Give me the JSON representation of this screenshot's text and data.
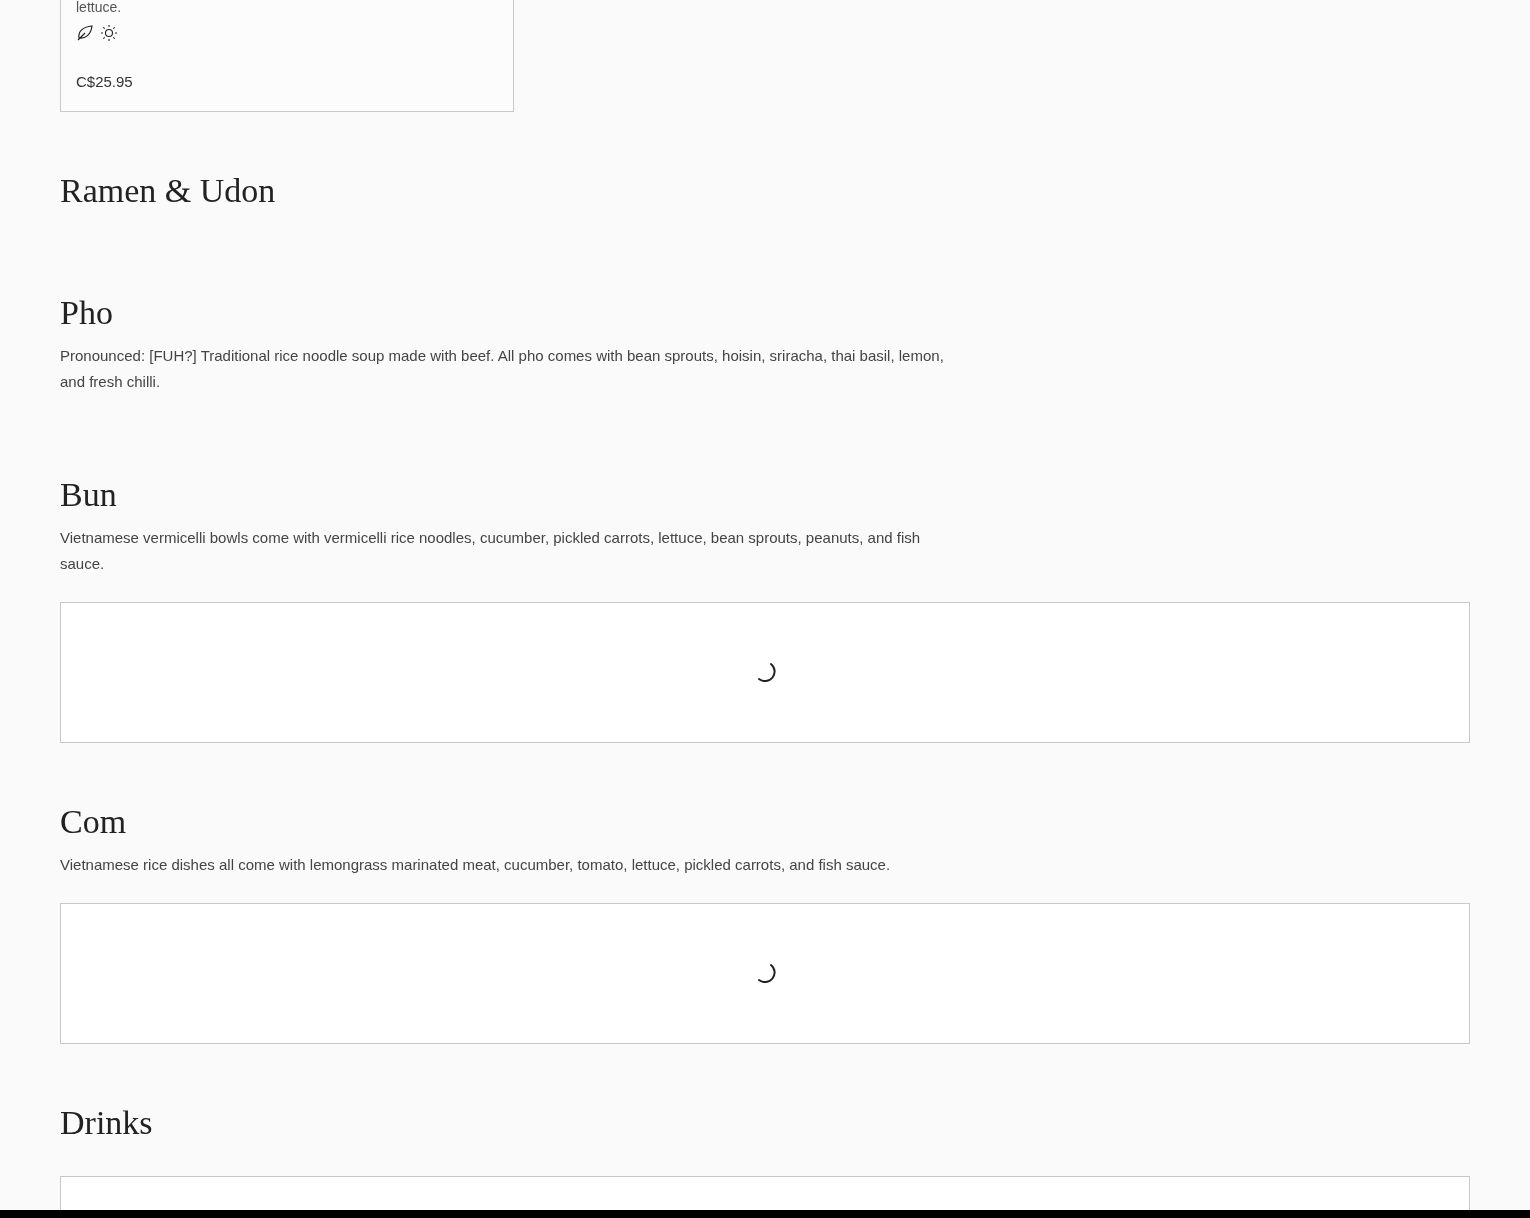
{
  "top_card": {
    "description": "lettuce.",
    "price": "C$25.95"
  },
  "sections": [
    {
      "title": "Ramen & Udon",
      "loading": false
    },
    {
      "title": "Pho",
      "description": "Pronounced: [FUH?] Traditional rice noodle soup made with beef. All pho comes with bean sprouts, hoisin, sriracha, thai basil, lemon, and fresh chilli.",
      "loading": false
    },
    {
      "title": "Bun",
      "description": "Vietnamese vermicelli bowls come with vermicelli rice noodles, cucumber, pickled carrots, lettuce, bean sprouts, peanuts, and fish sauce.",
      "loading": true
    },
    {
      "title": "Com",
      "description": "Vietnamese rice dishes all come with lemongrass marinated meat, cucumber, tomato, lettuce, pickled carrots, and fish sauce.",
      "loading": true
    },
    {
      "title": "Drinks",
      "loading": false,
      "partial_box": true
    }
  ]
}
